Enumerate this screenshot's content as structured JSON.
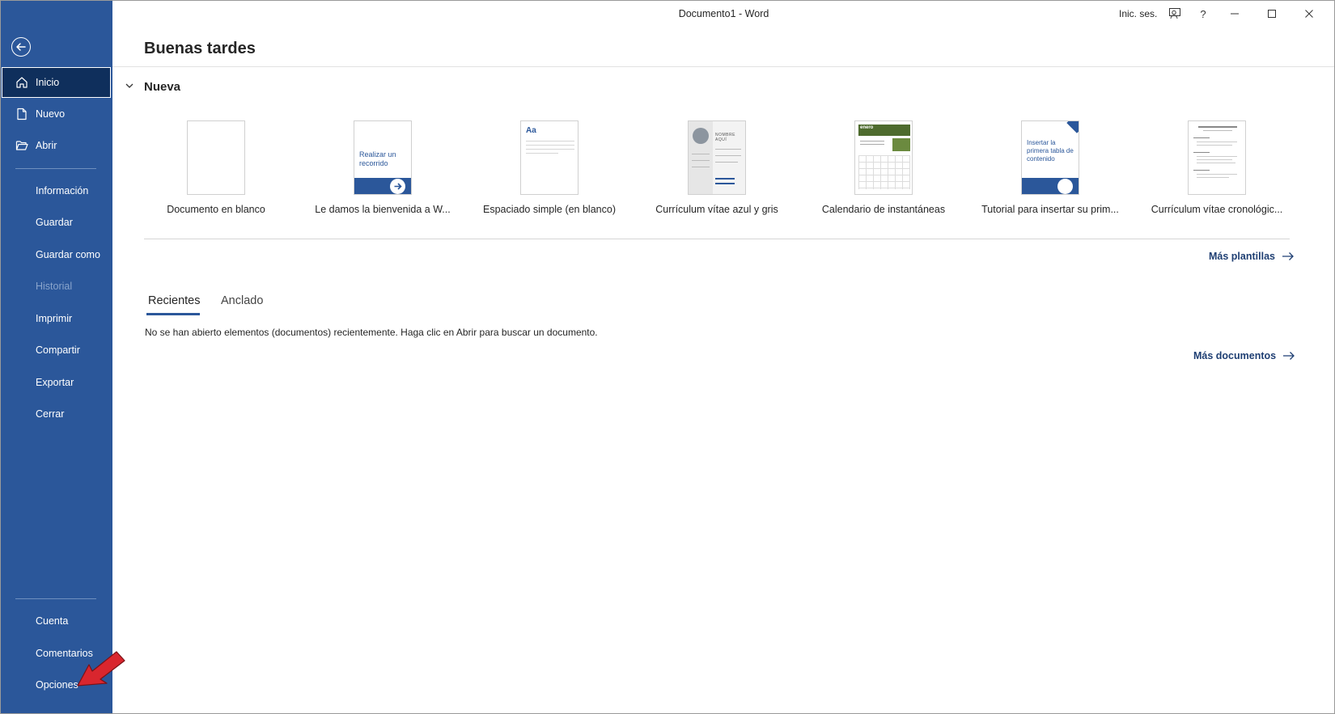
{
  "window": {
    "title": "Documento1  -  Word",
    "sign_in": "Inic. ses."
  },
  "sidebar": {
    "items": [
      {
        "label": "Inicio",
        "icon": "home-icon"
      },
      {
        "label": "Nuevo",
        "icon": "new-doc-icon"
      },
      {
        "label": "Abrir",
        "icon": "folder-open-icon"
      },
      {
        "label": "Información"
      },
      {
        "label": "Guardar"
      },
      {
        "label": "Guardar como"
      },
      {
        "label": "Historial"
      },
      {
        "label": "Imprimir"
      },
      {
        "label": "Compartir"
      },
      {
        "label": "Exportar"
      },
      {
        "label": "Cerrar"
      },
      {
        "label": "Cuenta"
      },
      {
        "label": "Comentarios"
      },
      {
        "label": "Opciones"
      }
    ]
  },
  "main": {
    "greeting": "Buenas tardes",
    "new_section": {
      "title": "Nueva",
      "templates": [
        {
          "caption": "Documento en blanco"
        },
        {
          "caption": "Le damos la bienvenida a W...",
          "thumb_text": "Realizar un recorrido"
        },
        {
          "caption": "Espaciado simple (en blanco)",
          "thumb_text": "Aa"
        },
        {
          "caption": "Currículum vítae azul y gris",
          "thumb_text": "NOMBRE AQUÍ"
        },
        {
          "caption": "Calendario de instantáneas",
          "thumb_text": "enero"
        },
        {
          "caption": "Tutorial para insertar su prim...",
          "thumb_text": "Insertar la primera tabla de contenido"
        },
        {
          "caption": "Currículum vítae cronológic..."
        }
      ],
      "more_templates": "Más plantillas"
    },
    "tabs": [
      {
        "label": "Recientes"
      },
      {
        "label": "Anclado"
      }
    ],
    "empty_message": "No se han abierto elementos (documentos) recientemente. Haga clic en Abrir para buscar un documento.",
    "more_documents": "Más documentos"
  },
  "colors": {
    "sidebar_bg": "#2b579a",
    "sidebar_active": "#0f2f5c",
    "link": "#1f3f73",
    "annotation_arrow": "#d9262e"
  }
}
